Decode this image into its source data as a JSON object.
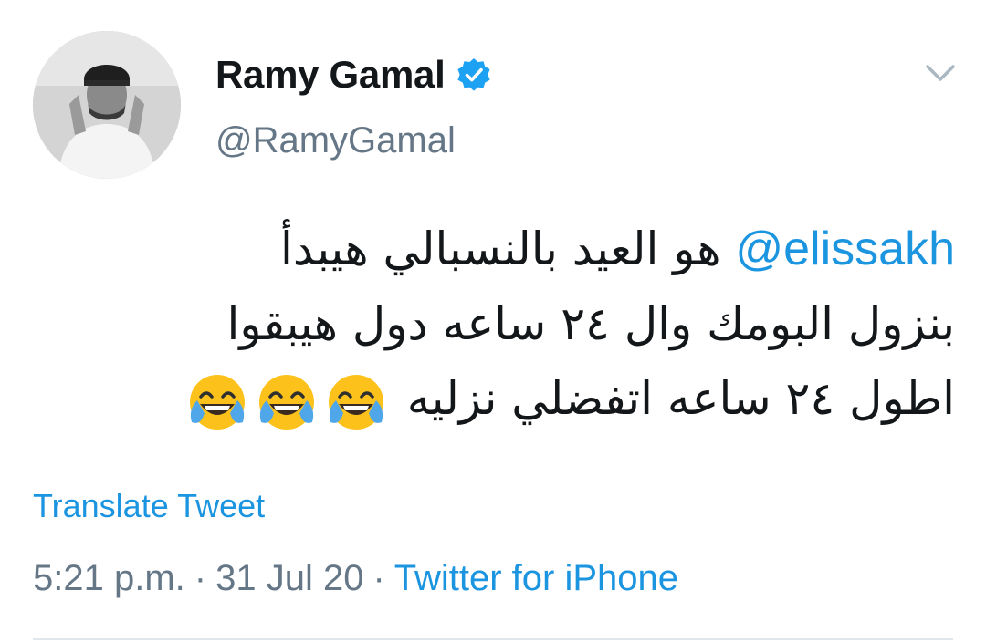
{
  "author": {
    "display_name": "Ramy Gamal",
    "handle": "@RamyGamal",
    "verified": true,
    "avatar_icon": "profile-photo"
  },
  "tweet": {
    "mention": "@elissakh",
    "line1_text": "هو العيد بالنسبالي هيبدأ",
    "line2_text": "بنزول البومك وال ٢٤ ساعه دول هيبقوا",
    "line3_text": "اطول ٢٤ ساعه اتفضلي نزليه",
    "emoji_name": "face-with-tears-of-joy",
    "emoji_count": 3
  },
  "translate_label": "Translate Tweet",
  "meta": {
    "time": "5:21 p.m.",
    "separator": "·",
    "date": "31 Jul 20",
    "source": "Twitter for iPhone"
  },
  "colors": {
    "link": "#1b95e0",
    "text": "#14171a",
    "secondary": "#657786",
    "divider": "#e1e8ed"
  },
  "icons": {
    "verified": "verified-badge-icon",
    "caret": "chevron-down-icon"
  }
}
